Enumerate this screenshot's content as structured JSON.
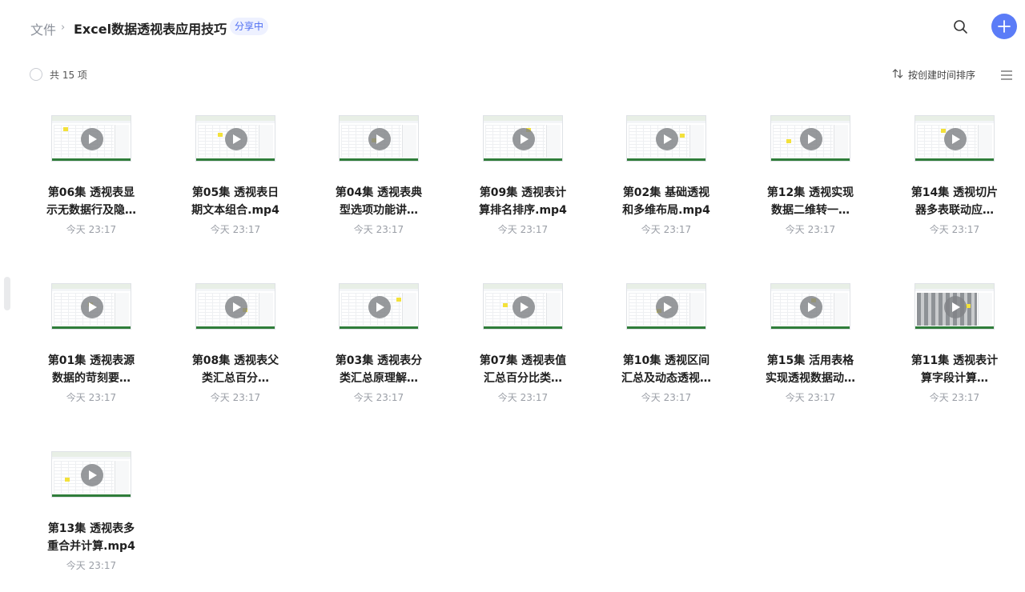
{
  "header": {
    "breadcrumb_root": "文件",
    "breadcrumb_sep": "›",
    "folder_title": "Excel数据透视表应用技巧",
    "share_badge": "分享中"
  },
  "toolbar": {
    "count_label": "共 15 项",
    "sort_label": "按创建时间排序"
  },
  "icons": {
    "search": "search-icon",
    "add": "plus-icon",
    "sort": "sort-arrows-icon",
    "list_view": "list-view-icon",
    "play": "play-icon"
  },
  "colors": {
    "accent": "#5b7cf7",
    "badge_bg": "#eef1ff",
    "badge_text": "#4f6ef2"
  },
  "files": [
    {
      "line1": "第06集 透视表显",
      "line2": "示无数据行及隐…",
      "time": "今天 23:17",
      "thumb": "light"
    },
    {
      "line1": "第05集 透视表日",
      "line2": "期文本组合.mp4",
      "time": "今天 23:17",
      "thumb": "light"
    },
    {
      "line1": "第04集 透视表典",
      "line2": "型选项功能讲…",
      "time": "今天 23:17",
      "thumb": "light"
    },
    {
      "line1": "第09集 透视表计",
      "line2": "算排名排序.mp4",
      "time": "今天 23:17",
      "thumb": "light"
    },
    {
      "line1": "第02集 基础透视",
      "line2": "和多维布局.mp4",
      "time": "今天 23:17",
      "thumb": "light"
    },
    {
      "line1": "第12集 透视实现",
      "line2": "数据二维转一…",
      "time": "今天 23:17",
      "thumb": "light"
    },
    {
      "line1": "第14集 透视切片",
      "line2": "器多表联动应…",
      "time": "今天 23:17",
      "thumb": "light"
    },
    {
      "line1": "第01集 透视表源",
      "line2": "数据的苛刻要…",
      "time": "今天 23:17",
      "thumb": "light"
    },
    {
      "line1": "第08集 透视表父",
      "line2": "类汇总百分…",
      "time": "今天 23:17",
      "thumb": "light"
    },
    {
      "line1": "第03集 透视表分",
      "line2": "类汇总原理解…",
      "time": "今天 23:17",
      "thumb": "light"
    },
    {
      "line1": "第07集 透视表值",
      "line2": "汇总百分比类…",
      "time": "今天 23:17",
      "thumb": "light"
    },
    {
      "line1": "第10集 透视区间",
      "line2": "汇总及动态透视…",
      "time": "今天 23:17",
      "thumb": "light"
    },
    {
      "line1": "第15集 活用表格",
      "line2": "实现透视数据动…",
      "time": "今天 23:17",
      "thumb": "light"
    },
    {
      "line1": "第11集 透视表计",
      "line2": "算字段计算…",
      "time": "今天 23:17",
      "thumb": "dark"
    },
    {
      "line1": "第13集 透视表多",
      "line2": "重合并计算.mp4",
      "time": "今天 23:17",
      "thumb": "light"
    }
  ]
}
